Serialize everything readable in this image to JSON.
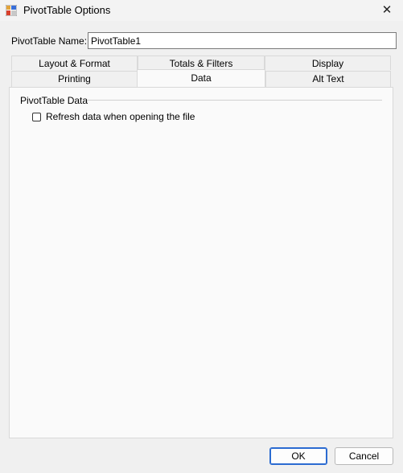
{
  "window": {
    "title": "PivotTable Options",
    "close_glyph": "✕",
    "app_icon": "pivottable-icon"
  },
  "name_field": {
    "label": "PivotTable Name:",
    "value": "PivotTable1"
  },
  "tabs": {
    "row1": [
      {
        "label": "Layout & Format"
      },
      {
        "label": "Totals & Filters"
      },
      {
        "label": "Display"
      }
    ],
    "row2": [
      {
        "label": "Printing"
      },
      {
        "label": "Data",
        "selected": true
      },
      {
        "label": "Alt Text"
      }
    ]
  },
  "data_tab": {
    "group_title": "PivotTable Data",
    "refresh_checkbox": {
      "label": "Refresh data when opening the file",
      "checked": false
    }
  },
  "buttons": {
    "ok": "OK",
    "cancel": "Cancel"
  },
  "colors": {
    "accent": "#2b6bd1",
    "background": "#f0f0f0",
    "panel": "#fafafa"
  }
}
